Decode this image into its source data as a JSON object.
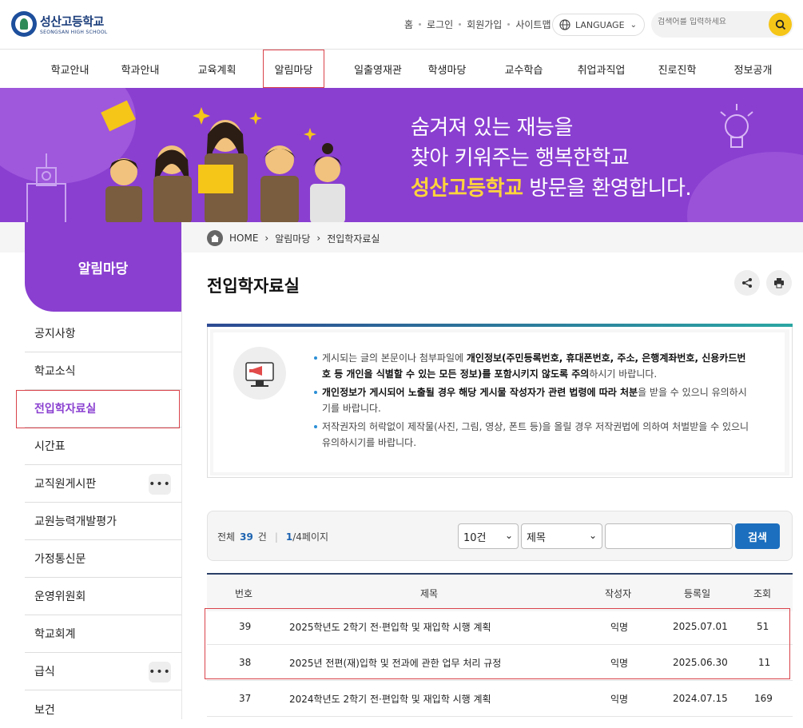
{
  "header": {
    "logo_kr": "성산고등학교",
    "logo_en": "SEONGSAN HIGH SCHOOL",
    "util_links": [
      "홈",
      "로그인",
      "회원가입",
      "사이트맵"
    ],
    "language_label": "LANGUAGE",
    "search_placeholder": "검색어를 입력하세요"
  },
  "gnb": [
    "학교안내",
    "학과안내",
    "교육계획",
    "알림마당",
    "일출영재관",
    "학생마당",
    "교수학습",
    "취업과직업",
    "진로진학",
    "정보공개"
  ],
  "banner": {
    "line1": "숨겨져 있는 재능을",
    "line2": "찾아 키워주는 행복한학교",
    "line3_highlight": "성산고등학교",
    "line3_rest": " 방문을 환영합니다."
  },
  "breadcrumb": [
    "HOME",
    "알림마당",
    "전입학자료실"
  ],
  "sidebar": {
    "title": "알림마당",
    "items": [
      {
        "label": "공지사항"
      },
      {
        "label": "학교소식"
      },
      {
        "label": "전입학자료실"
      },
      {
        "label": "시간표"
      },
      {
        "label": "교직원게시판"
      },
      {
        "label": "교원능력개발평가"
      },
      {
        "label": "가정통신문"
      },
      {
        "label": "운영위원회"
      },
      {
        "label": "학교회계"
      },
      {
        "label": "급식"
      },
      {
        "label": "보건"
      }
    ]
  },
  "page": {
    "title": "전입학자료실"
  },
  "notice": {
    "b1_a": "게시되는 글의 본문이나 첨부파일에 ",
    "b1_b": "개인정보(주민등록번호, 휴대폰번호, 주소, 은행계좌번호, 신용카드번호 등 개인을 식별할 수 있는 모든 정보)를 포함시키지 않도록 주의",
    "b1_c": "하시기 바랍니다.",
    "b2_a": "개인정보가 게시되어 노출될 경우 해당 게시물 작성자가 관련 법령에 따라 처분",
    "b2_b": "을 받을 수 있으니 유의하시기를 바랍니다.",
    "b3": "저작권자의 허락없이 제작물(사진, 그림, 영상, 폰트 등)을 올릴 경우 저작권법에 의하여 처벌받을 수 있으니 유의하시기를 바랍니다."
  },
  "filter": {
    "total_label": "전체",
    "total_count": "39",
    "total_unit": "건",
    "page_current": "1",
    "page_rest": "/4페이지",
    "per_page": "10건",
    "field": "제목",
    "search_button": "검색"
  },
  "table": {
    "headers": [
      "번호",
      "제목",
      "작성자",
      "등록일",
      "조회"
    ],
    "rows": [
      {
        "no": "39",
        "title": "2025학년도 2학기 전·편입학 및 재입학 시행 계획",
        "author": "익명",
        "date": "2025.07.01",
        "views": "51"
      },
      {
        "no": "38",
        "title": "2025년 전편(재)입학 및 전과에 관한 업무 처리 규정",
        "author": "익명",
        "date": "2025.06.30",
        "views": "11"
      },
      {
        "no": "37",
        "title": "2024학년도 2학기 전·편입학 및 재입학 시행 계획",
        "author": "익명",
        "date": "2024.07.15",
        "views": "169"
      }
    ]
  },
  "colors": {
    "brand_purple": "#8a3fd0",
    "highlight_red": "#d9434b",
    "search_blue": "#1c6fbe",
    "yellow": "#f5c518"
  }
}
